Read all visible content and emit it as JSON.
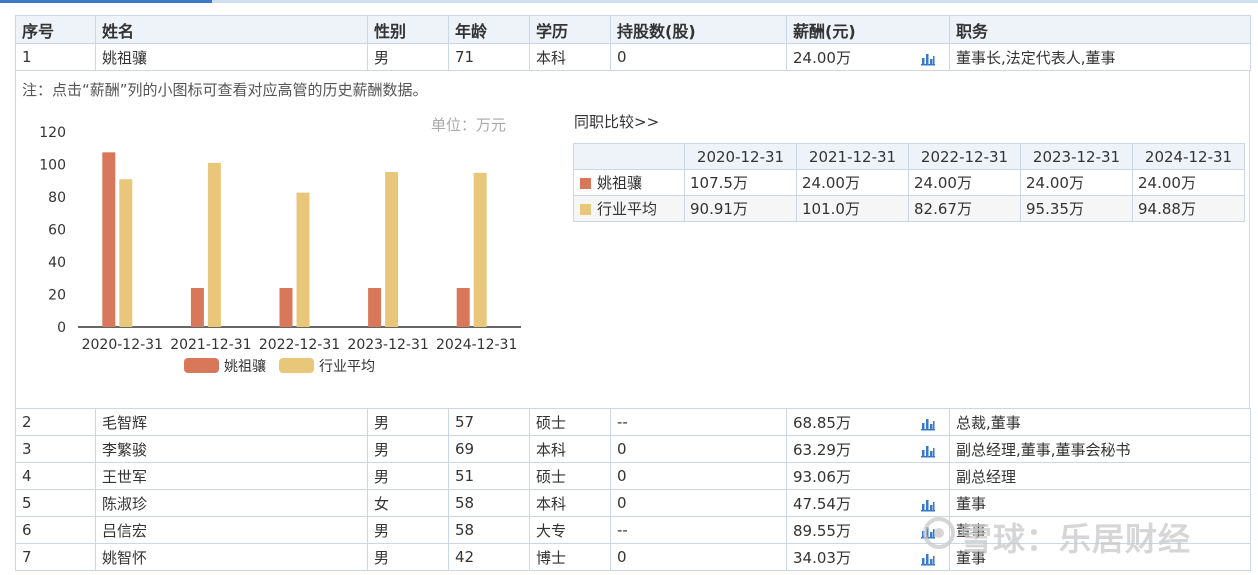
{
  "columns": [
    "序号",
    "姓名",
    "性别",
    "年龄",
    "学历",
    "持股数(股)",
    "薪酬(元)",
    "职务"
  ],
  "rows": [
    {
      "no": "1",
      "name": "姚祖骧",
      "gender": "男",
      "age": "71",
      "edu": "本科",
      "shares": "0",
      "salary": "24.00万",
      "chart_icon": true,
      "title": "董事长,法定代表人,董事"
    },
    {
      "no": "2",
      "name": "毛智辉",
      "gender": "男",
      "age": "57",
      "edu": "硕士",
      "shares": "--",
      "salary": "68.85万",
      "chart_icon": true,
      "title": "总裁,董事"
    },
    {
      "no": "3",
      "name": "李繁骏",
      "gender": "男",
      "age": "69",
      "edu": "本科",
      "shares": "0",
      "salary": "63.29万",
      "chart_icon": true,
      "title": "副总经理,董事,董事会秘书"
    },
    {
      "no": "4",
      "name": "王世军",
      "gender": "男",
      "age": "51",
      "edu": "硕士",
      "shares": "0",
      "salary": "93.06万",
      "chart_icon": false,
      "title": "副总经理"
    },
    {
      "no": "5",
      "name": "陈淑珍",
      "gender": "女",
      "age": "58",
      "edu": "本科",
      "shares": "0",
      "salary": "47.54万",
      "chart_icon": true,
      "title": "董事"
    },
    {
      "no": "6",
      "name": "吕信宏",
      "gender": "男",
      "age": "58",
      "edu": "大专",
      "shares": "--",
      "salary": "89.55万",
      "chart_icon": true,
      "title": "董事"
    },
    {
      "no": "7",
      "name": "姚智怀",
      "gender": "男",
      "age": "42",
      "edu": "博士",
      "shares": "0",
      "salary": "34.03万",
      "chart_icon": true,
      "title": "董事"
    }
  ],
  "note": "注：点击“薪酬”列的小图标可查看对应高管的历史薪酬数据。",
  "unit_label": "单位：万元",
  "compare": {
    "title": "同职比较>>",
    "dates": [
      "2020-12-31",
      "2021-12-31",
      "2022-12-31",
      "2023-12-31",
      "2024-12-31"
    ],
    "rows": [
      {
        "label": "姚祖骧",
        "values": [
          "107.5万",
          "24.00万",
          "24.00万",
          "24.00万",
          "24.00万"
        ]
      },
      {
        "label": "行业平均",
        "values": [
          "90.91万",
          "101.0万",
          "82.67万",
          "95.35万",
          "94.88万"
        ]
      }
    ]
  },
  "chart_data": {
    "type": "bar",
    "categories": [
      "2020-12-31",
      "2021-12-31",
      "2022-12-31",
      "2023-12-31",
      "2024-12-31"
    ],
    "series": [
      {
        "name": "姚祖骧",
        "values": [
          107.5,
          24.0,
          24.0,
          24.0,
          24.0
        ],
        "color": "#d9775a"
      },
      {
        "name": "行业平均",
        "values": [
          90.91,
          101.0,
          82.67,
          95.35,
          94.88
        ],
        "color": "#e8c77a"
      }
    ],
    "yticks": [
      "0",
      "20",
      "40",
      "60",
      "80",
      "100",
      "120"
    ],
    "ylim": [
      0,
      120
    ],
    "legend": "bottom",
    "grid": false
  },
  "colors": {
    "series1": "#d9775a",
    "series2": "#e8c77a",
    "icon": "#3a78c9",
    "border": "#c9d7e6",
    "header_bg": "#eef3f9"
  },
  "watermark": "雪球：乐居财经"
}
